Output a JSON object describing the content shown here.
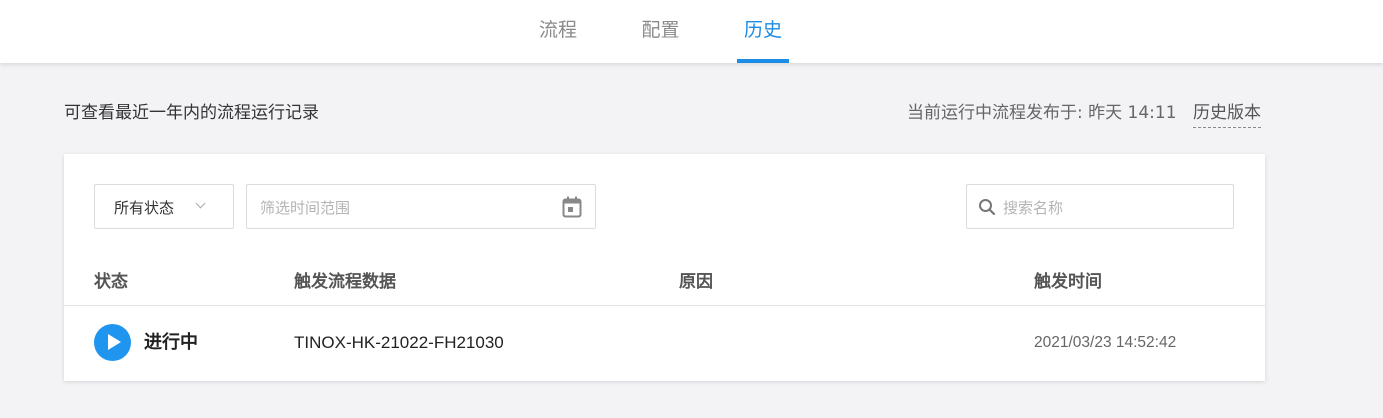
{
  "tabs": {
    "flow": "流程",
    "config": "配置",
    "history": "历史",
    "active": "history"
  },
  "colors": {
    "accent": "#1c8ce6",
    "running_icon": "#1f95ef",
    "background": "#f3f3f6"
  },
  "header": {
    "description": "可查看最近一年内的流程运行记录",
    "publish_info": "当前运行中流程发布于: 昨天 14:11",
    "history_versions_link": "历史版本"
  },
  "filters": {
    "status_select": {
      "selected": "所有状态"
    },
    "date_range": {
      "placeholder": "筛选时间范围",
      "icon": "calendar-icon"
    },
    "search": {
      "placeholder": "搜索名称",
      "icon": "search-icon"
    }
  },
  "table": {
    "columns": [
      "状态",
      "触发流程数据",
      "原因",
      "触发时间"
    ],
    "rows": [
      {
        "status_icon": "play-icon",
        "status": "进行中",
        "trigger_data": "TINOX-HK-21022-FH21030",
        "reason": "",
        "trigger_time": "2021/03/23 14:52:42"
      }
    ]
  }
}
